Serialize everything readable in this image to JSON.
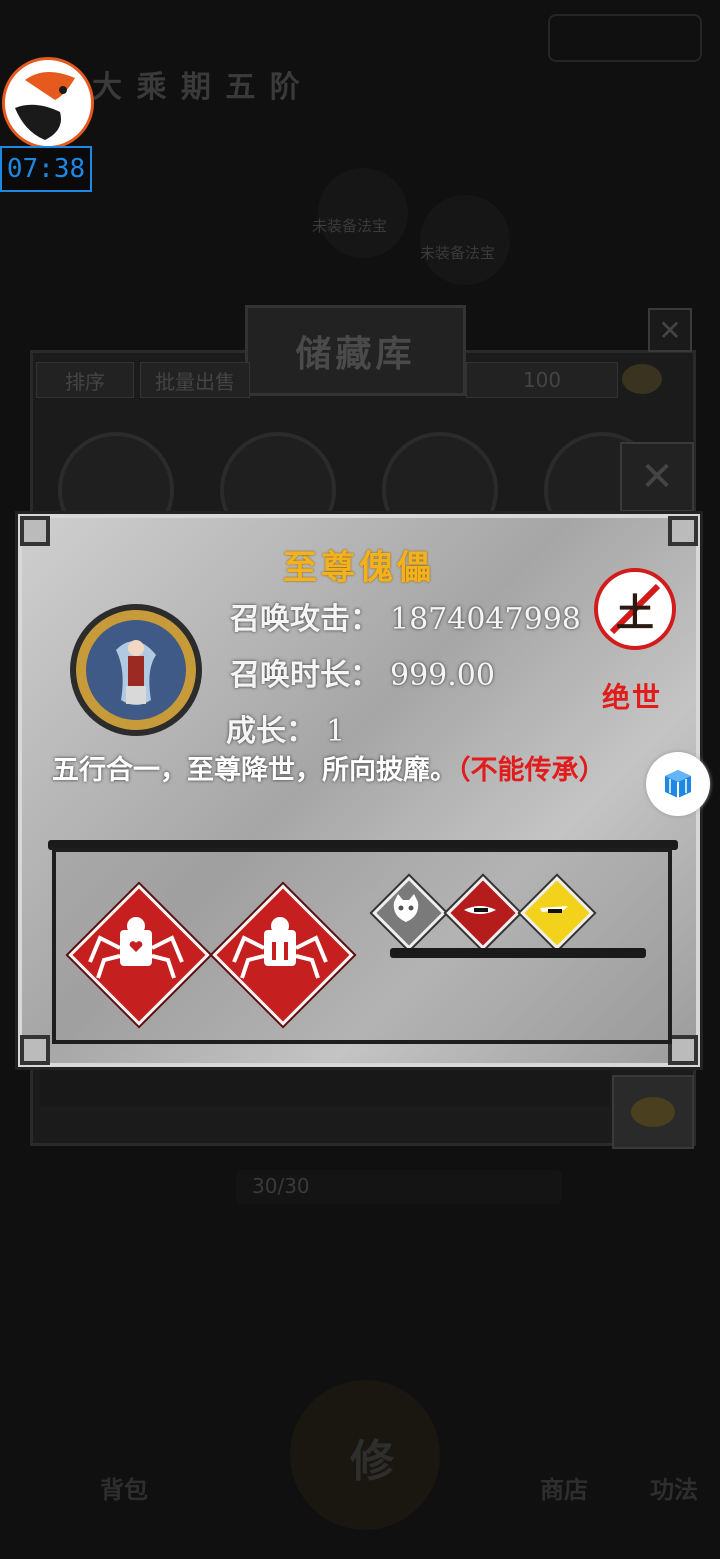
{
  "hud": {
    "timer": "07:38",
    "stage_title": "大 乘 期 五 阶"
  },
  "background": {
    "faint_text_1": "未装备法宝",
    "faint_text_2": "未装备法宝",
    "storage_title": "储藏库",
    "tabs": {
      "sort": "排序",
      "batch_sell": "批量出售"
    },
    "capacity": "100",
    "bag_count": "30/30",
    "nav": {
      "bag_label": "背包",
      "shop_label": "商店",
      "skill_label": "功法",
      "center_label": "修"
    }
  },
  "item": {
    "name": "至尊傀儡",
    "stats": [
      {
        "label": "召唤攻击",
        "value": "1874047998"
      },
      {
        "label": "召唤时长",
        "value": "999.00"
      },
      {
        "label": "成长",
        "value": "1"
      }
    ],
    "separator": "：",
    "element_char": "土",
    "rarity": "绝世",
    "description": "五行合一，至尊降世，所向披靡。",
    "note": "（不能传承）"
  },
  "colors": {
    "accent_gold": "#f3b21b",
    "rarity_red": "#e21b1b",
    "timer_blue": "#1e88e5"
  },
  "icons": {
    "skill_1": "spider-puppet-heart-icon",
    "skill_2": "spider-puppet-icon",
    "small_1": "demon-cat-icon",
    "small_2": "red-minus-icon",
    "small_3": "yellow-minus-icon"
  }
}
